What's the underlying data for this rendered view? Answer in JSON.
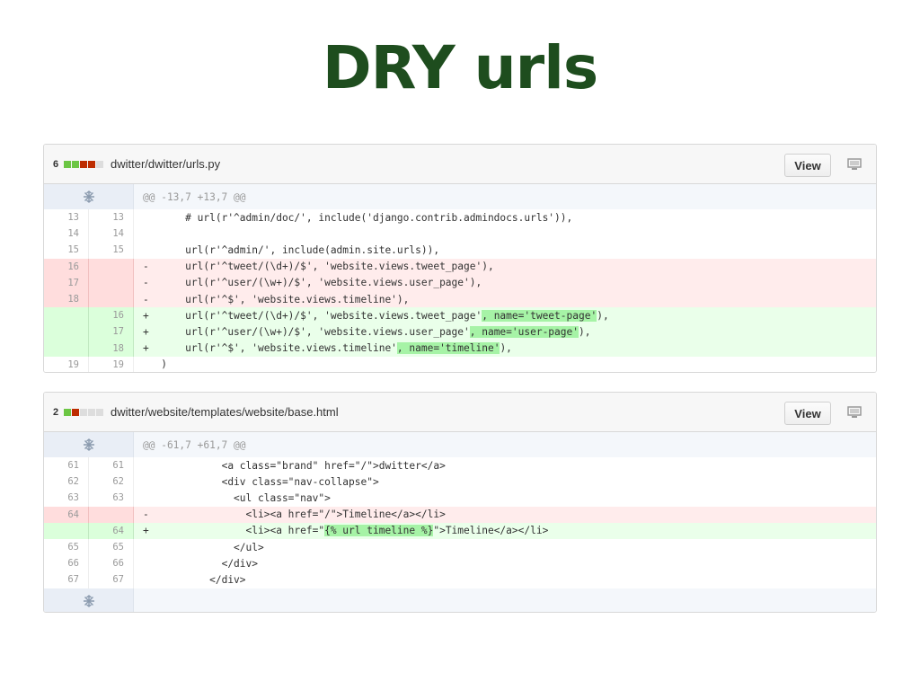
{
  "slide": {
    "title": "DRY urls"
  },
  "files": [
    {
      "count": "6",
      "path": "dwitter/dwitter/urls.py",
      "view_label": "View",
      "hunk": "@@ -13,7 +13,7 @@",
      "lines": [
        {
          "type": "ctx",
          "old": "13",
          "new": "13",
          "marker": " ",
          "code": "    # url(r'^admin/doc/', include('django.contrib.admindocs.urls')),"
        },
        {
          "type": "ctx",
          "old": "14",
          "new": "14",
          "marker": " ",
          "code": ""
        },
        {
          "type": "ctx",
          "old": "15",
          "new": "15",
          "marker": " ",
          "code": "    url(r'^admin/', include(admin.site.urls)),"
        },
        {
          "type": "del",
          "old": "16",
          "new": "",
          "marker": "-",
          "code": "    url(r'^tweet/(\\d+)/$', 'website.views.tweet_page'),"
        },
        {
          "type": "del",
          "old": "17",
          "new": "",
          "marker": "-",
          "code": "    url(r'^user/(\\w+)/$', 'website.views.user_page'),"
        },
        {
          "type": "del",
          "old": "18",
          "new": "",
          "marker": "-",
          "code": "    url(r'^$', 'website.views.timeline'),"
        },
        {
          "type": "add",
          "old": "",
          "new": "16",
          "marker": "+",
          "code_pre": "    url(r'^tweet/(\\d+)/$', 'website.views.tweet_page'",
          "code_hl": ", name='tweet-page'",
          "code_post": "),"
        },
        {
          "type": "add",
          "old": "",
          "new": "17",
          "marker": "+",
          "code_pre": "    url(r'^user/(\\w+)/$', 'website.views.user_page'",
          "code_hl": ", name='user-page'",
          "code_post": "),"
        },
        {
          "type": "add",
          "old": "",
          "new": "18",
          "marker": "+",
          "code_pre": "    url(r'^$', 'website.views.timeline'",
          "code_hl": ", name='timeline'",
          "code_post": "),"
        },
        {
          "type": "ctx",
          "old": "19",
          "new": "19",
          "marker": " ",
          "code": ")"
        }
      ]
    },
    {
      "count": "2",
      "path": "dwitter/website/templates/website/base.html",
      "view_label": "View",
      "hunk": "@@ -61,7 +61,7 @@",
      "lines": [
        {
          "type": "ctx",
          "old": "61",
          "new": "61",
          "marker": " ",
          "code": "          <a class=\"brand\" href=\"/\">dwitter</a>"
        },
        {
          "type": "ctx",
          "old": "62",
          "new": "62",
          "marker": " ",
          "code": "          <div class=\"nav-collapse\">"
        },
        {
          "type": "ctx",
          "old": "63",
          "new": "63",
          "marker": " ",
          "code": "            <ul class=\"nav\">"
        },
        {
          "type": "del",
          "old": "64",
          "new": "",
          "marker": "-",
          "code": "              <li><a href=\"/\">Timeline</a></li>"
        },
        {
          "type": "add",
          "old": "",
          "new": "64",
          "marker": "+",
          "code_pre": "              <li><a href=\"",
          "code_hl": "{% url timeline %}",
          "code_post": "\">Timeline</a></li>"
        },
        {
          "type": "ctx",
          "old": "65",
          "new": "65",
          "marker": " ",
          "code": "            </ul>"
        },
        {
          "type": "ctx",
          "old": "66",
          "new": "66",
          "marker": " ",
          "code": "          </div>"
        },
        {
          "type": "ctx",
          "old": "67",
          "new": "67",
          "marker": " ",
          "code": "        </div>"
        }
      ]
    }
  ],
  "colors": {
    "title": "#1e4d1e",
    "add_bg": "#eaffea",
    "del_bg": "#ffecec",
    "add_highlight": "#a6f3a6"
  },
  "icons": {
    "expand": "expand-icon",
    "display": "monitor-icon"
  }
}
